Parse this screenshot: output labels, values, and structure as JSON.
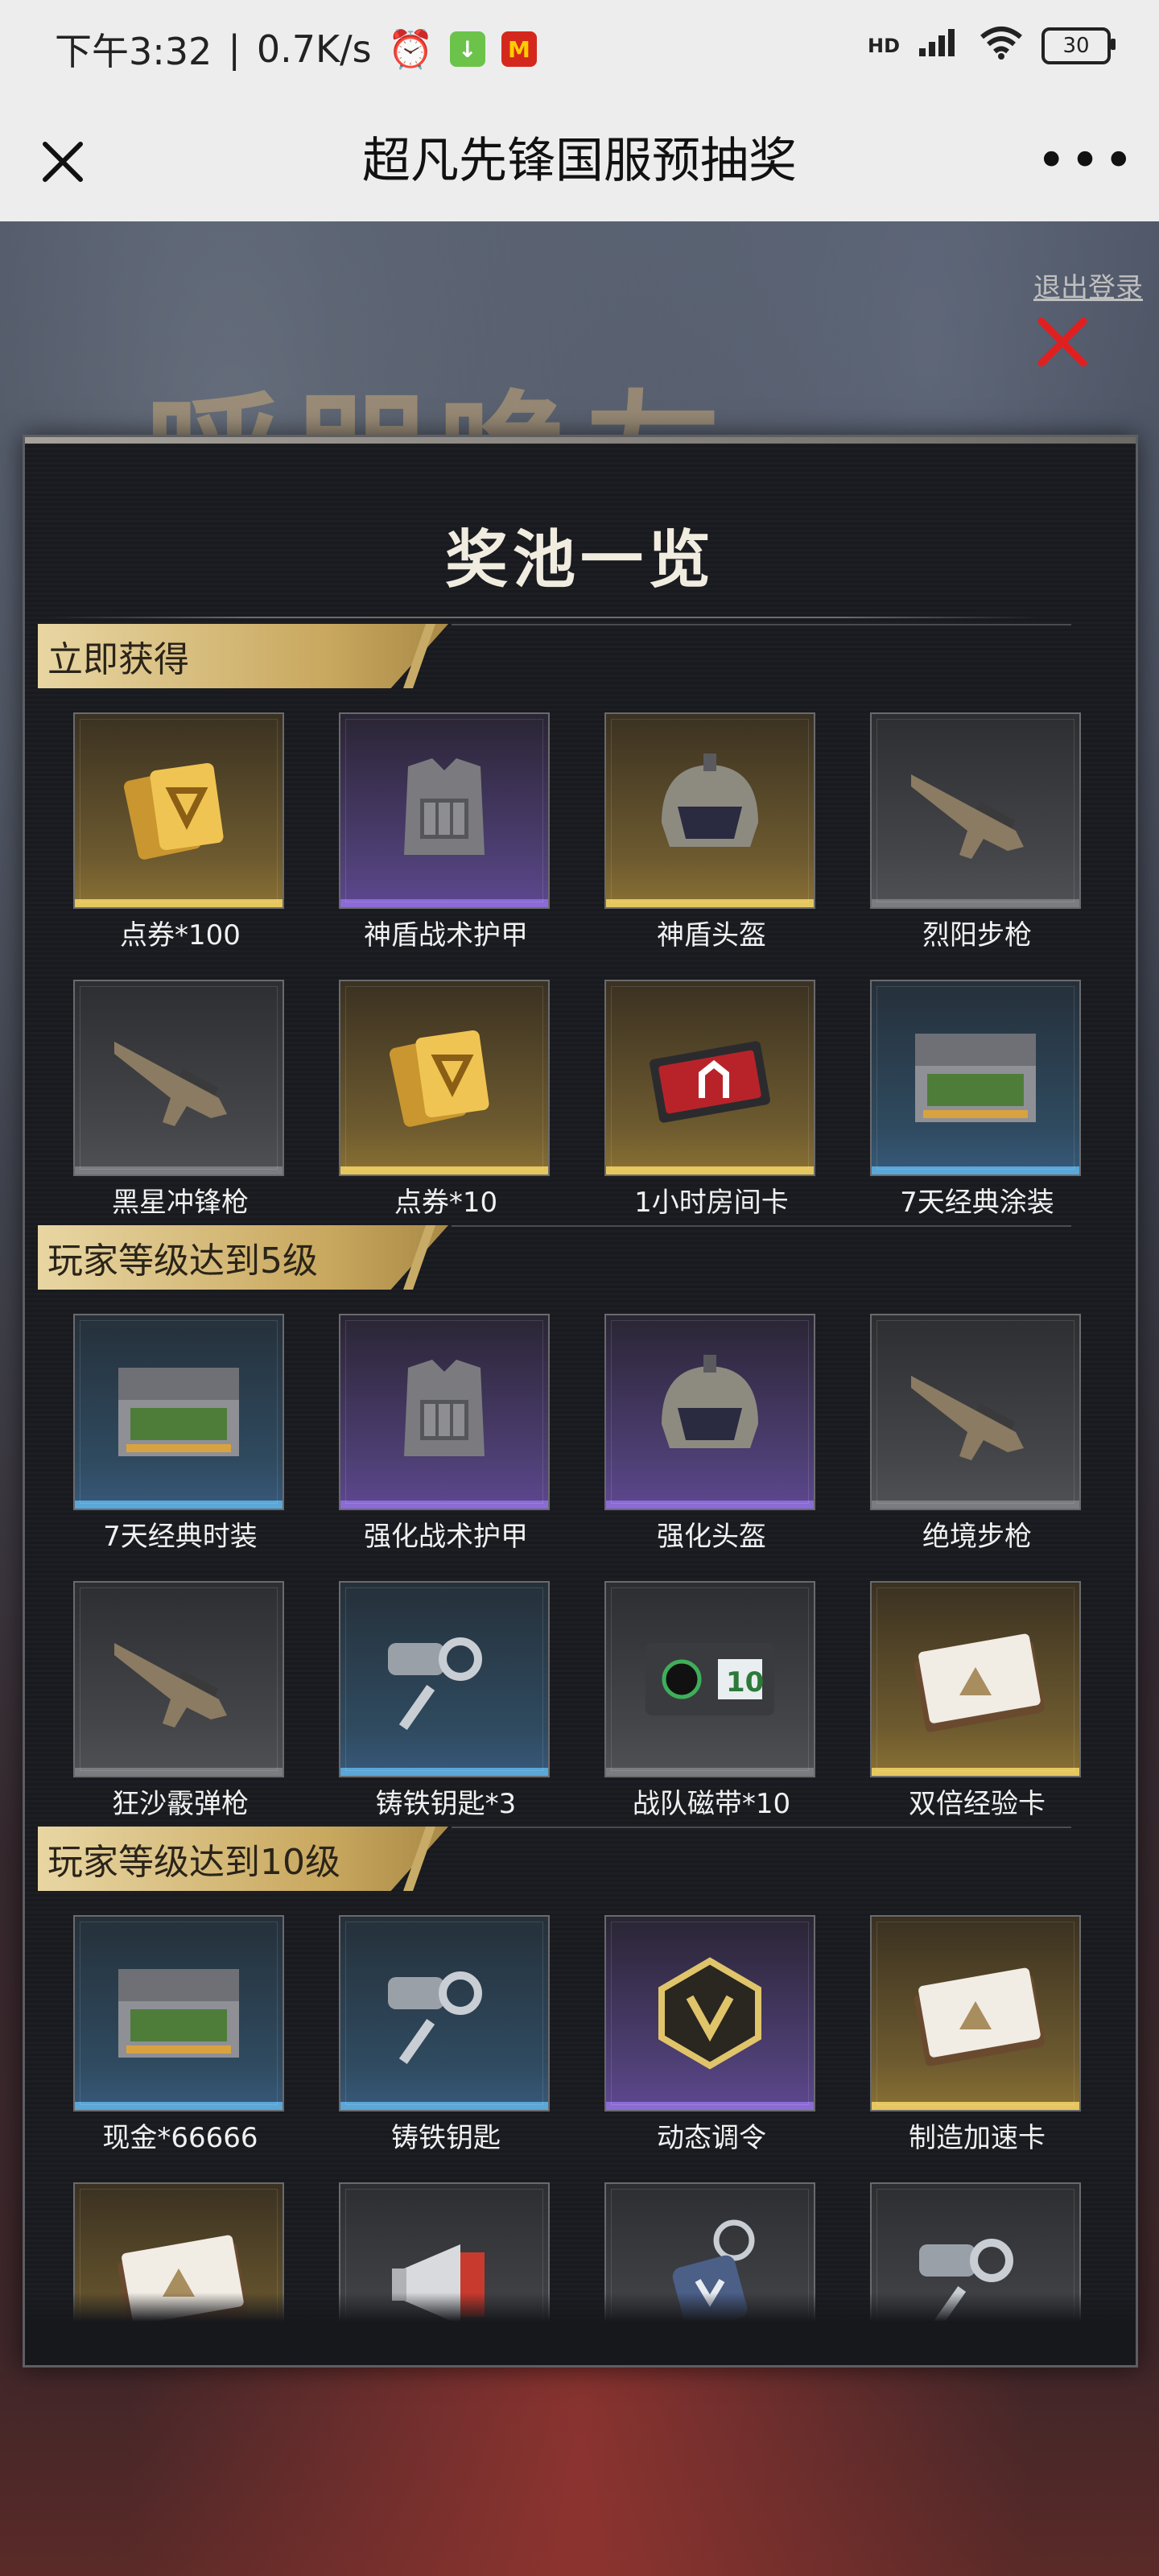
{
  "status_bar": {
    "time": "下午3:32",
    "speed": "0.7K/s",
    "signal_label": "HD",
    "battery": "30"
  },
  "nav": {
    "title": "超凡先锋国服预抽奖"
  },
  "background": {
    "headline": "呼朋唤友",
    "logout_label": "退出登录"
  },
  "panel": {
    "title": "奖池一览",
    "sections": [
      {
        "header": "立即获得",
        "items": [
          {
            "name": "点券*100",
            "rarity": "gold",
            "icon": "coupon-stack-icon"
          },
          {
            "name": "神盾战术护甲",
            "rarity": "purple",
            "icon": "armor-vest-icon"
          },
          {
            "name": "神盾头盔",
            "rarity": "gold",
            "icon": "helmet-icon"
          },
          {
            "name": "烈阳步枪",
            "rarity": "gray",
            "icon": "rifle-icon"
          },
          {
            "name": "黑星冲锋枪",
            "rarity": "gray",
            "icon": "smg-icon"
          },
          {
            "name": "点券*10",
            "rarity": "gold",
            "icon": "coupon-icon"
          },
          {
            "name": "1小时房间卡",
            "rarity": "gold",
            "icon": "room-card-icon"
          },
          {
            "name": "7天经典涂装",
            "rarity": "blue",
            "icon": "weapon-crate-icon"
          }
        ]
      },
      {
        "header": "玩家等级达到5级",
        "items": [
          {
            "name": "7天经典时装",
            "rarity": "blue",
            "icon": "outfit-crate-icon"
          },
          {
            "name": "强化战术护甲",
            "rarity": "purple",
            "icon": "armor-vest-icon"
          },
          {
            "name": "强化头盔",
            "rarity": "purple",
            "icon": "helmet-icon"
          },
          {
            "name": "绝境步枪",
            "rarity": "gray",
            "icon": "rifle-icon"
          },
          {
            "name": "狂沙霰弹枪",
            "rarity": "gray",
            "icon": "shotgun-icon"
          },
          {
            "name": "铸铁钥匙*3",
            "rarity": "blue",
            "icon": "key-icon"
          },
          {
            "name": "战队磁带*10",
            "rarity": "gray",
            "icon": "tape-icon"
          },
          {
            "name": "双倍经验卡",
            "rarity": "gold",
            "icon": "exp-card-icon"
          }
        ]
      },
      {
        "header": "玩家等级达到10级",
        "items": [
          {
            "name": "现金*66666",
            "rarity": "blue",
            "icon": "cash-case-icon"
          },
          {
            "name": "铸铁钥匙",
            "rarity": "blue",
            "icon": "key-icon"
          },
          {
            "name": "动态调令",
            "rarity": "purple",
            "icon": "badge-icon"
          },
          {
            "name": "制造加速卡",
            "rarity": "gold",
            "icon": "gear-card-icon"
          },
          {
            "name": "",
            "rarity": "gold",
            "icon": "profile-card-icon"
          },
          {
            "name": "",
            "rarity": "gray",
            "icon": "megaphone-icon"
          },
          {
            "name": "",
            "rarity": "gray",
            "icon": "keychain-icon"
          },
          {
            "name": "",
            "rarity": "gray",
            "icon": "key-icon"
          }
        ]
      }
    ]
  }
}
